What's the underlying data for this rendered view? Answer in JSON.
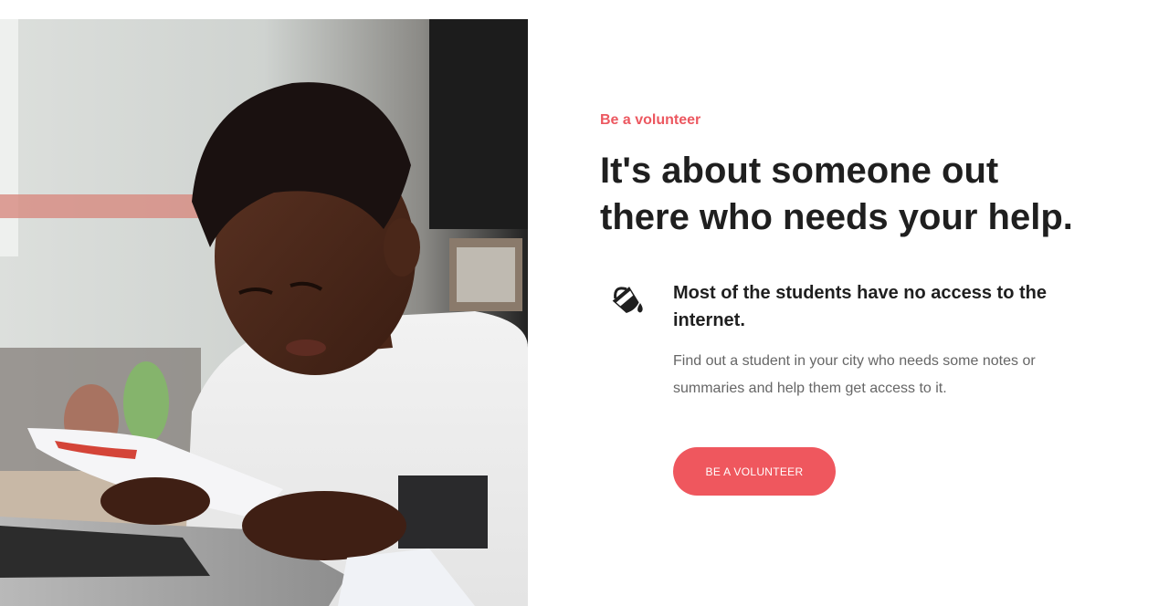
{
  "hero_image": {
    "alt": "Boy reading notes beside a laptop"
  },
  "volunteer": {
    "eyebrow": "Be a volunteer",
    "headline_line1": "It's about someone out",
    "headline_line2": "there who needs your help.",
    "feature": {
      "icon": "paint-bucket-icon",
      "title": "Most of the students have no access to the internet.",
      "text": "Find out a student in your city who needs some notes or summaries and help them get access to it."
    },
    "cta_label": "BE A VOLUNTEER"
  },
  "colors": {
    "accent": "#ef575e",
    "heading": "#1f1f1f",
    "body": "#666666"
  }
}
